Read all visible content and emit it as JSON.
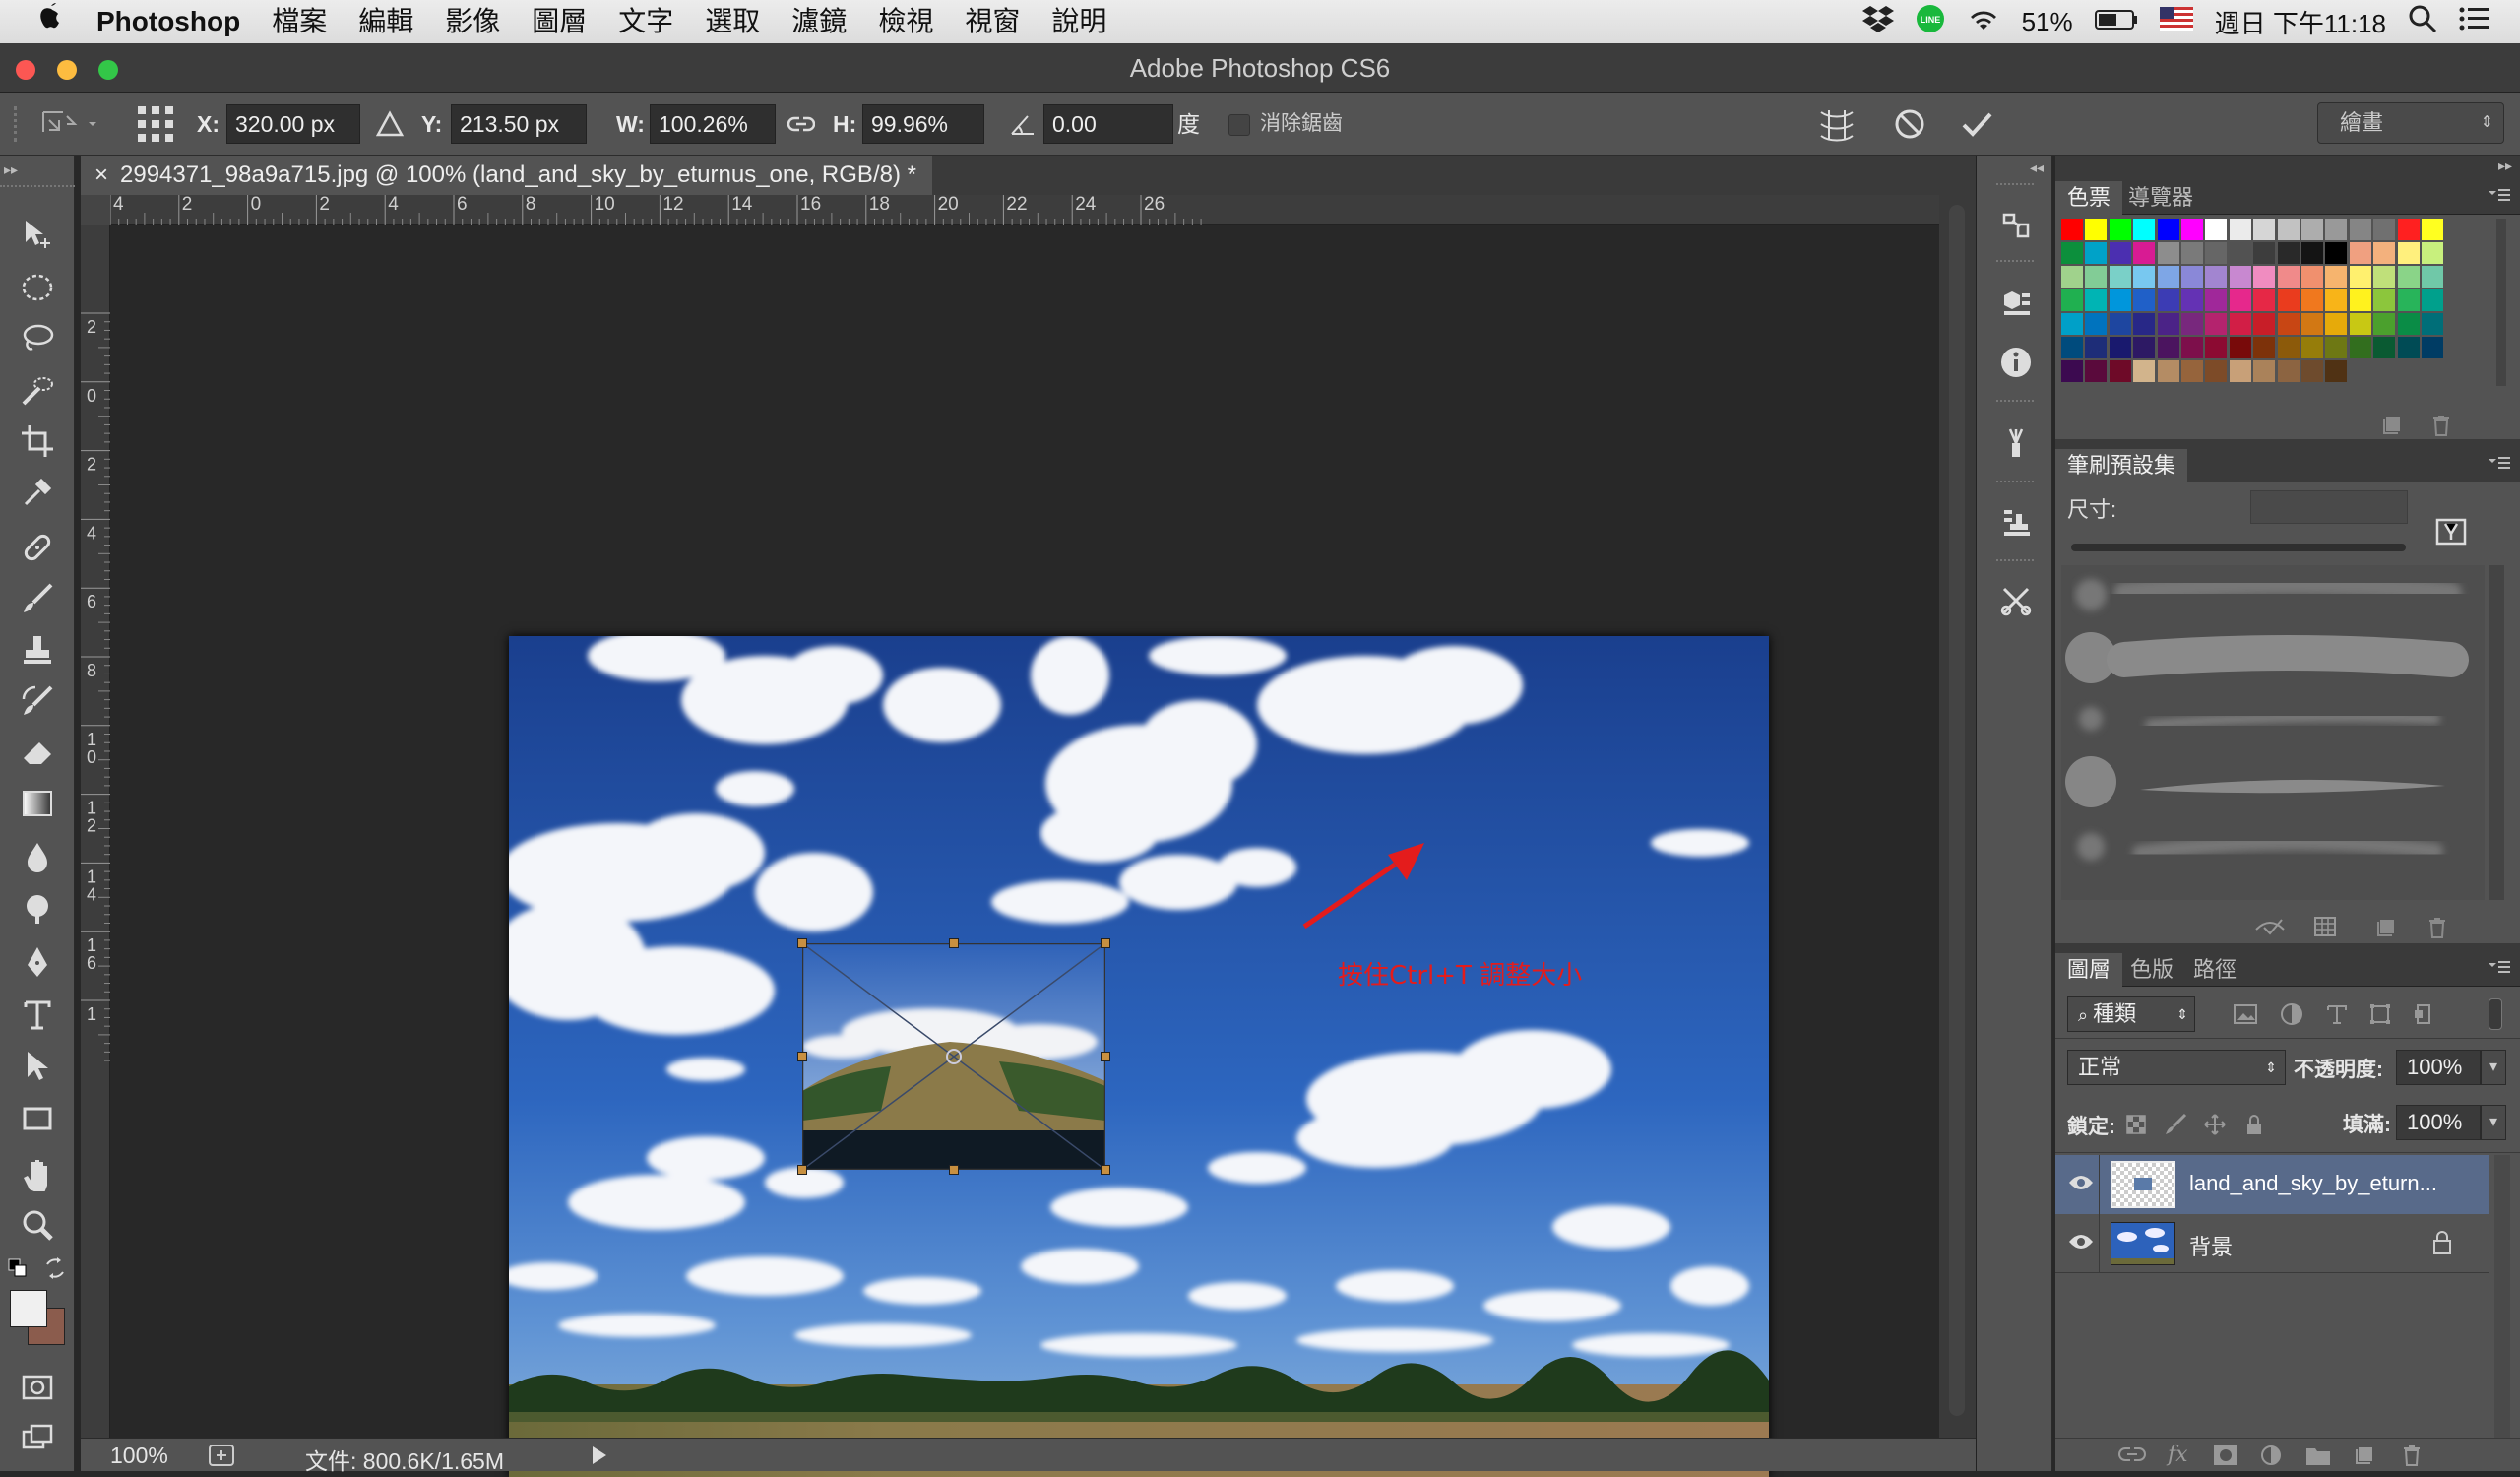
{
  "menubar": {
    "apple": "",
    "app": "Photoshop",
    "items": [
      "檔案",
      "編輯",
      "影像",
      "圖層",
      "文字",
      "選取",
      "濾鏡",
      "檢視",
      "視窗",
      "說明"
    ],
    "battery": "51%",
    "clock": "週日 下午11:18"
  },
  "window": {
    "title": "Adobe Photoshop CS6"
  },
  "options": {
    "x_label": "X:",
    "x_value": "320.00 px",
    "y_label": "Y:",
    "y_value": "213.50 px",
    "w_label": "W:",
    "w_value": "100.26%",
    "h_label": "H:",
    "h_value": "99.96%",
    "angle_value": "0.00",
    "angle_unit": "度",
    "antialias_label": "消除鋸齒",
    "workspace": "繪畫"
  },
  "document": {
    "tab_title": "2994371_98a9a715.jpg @ 100% (land_and_sky_by_eturnus_one, RGB/8) *",
    "close": "×",
    "annotation": "按住Ctrl+T 調整大小"
  },
  "rulers": {
    "h_ticks": [
      "4",
      "2",
      "0",
      "2",
      "4",
      "6",
      "8",
      "10",
      "12",
      "14",
      "16",
      "18",
      "20",
      "22",
      "24",
      "26"
    ],
    "v_ticks": [
      "2",
      "0",
      "2",
      "4",
      "6",
      "8",
      "1\n0",
      "1\n2",
      "1\n4",
      "1\n6",
      "1"
    ]
  },
  "status": {
    "zoom": "100%",
    "doc_info": "文件: 800.6K/1.65M"
  },
  "panels": {
    "swatches_tab": "色票",
    "navigator_tab": "導覽器",
    "brush_presets_tab": "筆刷預設集",
    "size_label": "尺寸:",
    "layers_tab": "圖層",
    "channels_tab": "色版",
    "paths_tab": "路徑",
    "kind_filter": "種類",
    "blend_mode": "正常",
    "opacity_label": "不透明度:",
    "opacity_value": "100%",
    "lock_label": "鎖定:",
    "fill_label": "填滿:",
    "fill_value": "100%"
  },
  "layers": [
    {
      "name": "land_and_sky_by_eturn...",
      "selected": true
    },
    {
      "name": "背景",
      "selected": false,
      "locked": true
    }
  ],
  "swatch_colors": [
    [
      "#ff0000",
      "#ffff00",
      "#00ff00",
      "#00ffff",
      "#0000ff",
      "#ff00ff",
      "#ffffff",
      "#ebebeb",
      "#d6d6d6",
      "#c2c2c2",
      "#adadad",
      "#999999",
      "#858585",
      "#707070",
      "#ff2020",
      "#ffff20"
    ],
    [
      "#0c8f3c",
      "#00a2c8",
      "#4b2fb0",
      "#d81b93",
      "#8d8d8d",
      "#7a7a7a",
      "#666666",
      "#525252",
      "#3d3d3d",
      "#292929",
      "#141414",
      "#000000",
      "#f0a080",
      "#f3b17d",
      "#fff07d",
      "#c8f07d"
    ],
    [
      "#a0d28c",
      "#82cc96",
      "#7ad0c8",
      "#78c8f0",
      "#7ea6e6",
      "#8a88d8",
      "#a285d0",
      "#c888d0",
      "#f08cc0",
      "#f08a8a",
      "#f0906e",
      "#f6b46e",
      "#fff06e",
      "#c0e07a",
      "#8ad488",
      "#70c8a8"
    ],
    [
      "#20b050",
      "#00b4b4",
      "#0096dc",
      "#2060c8",
      "#3c3cb4",
      "#6432b4",
      "#a0289a",
      "#e6288c",
      "#e62846",
      "#ea3c1e",
      "#f0781e",
      "#f8b418",
      "#fff21e",
      "#8cc63c",
      "#28b45a",
      "#00a08c"
    ],
    [
      "#00a0c8",
      "#0073be",
      "#1e46a0",
      "#282887",
      "#4b2387",
      "#78287d",
      "#b4236e",
      "#d21e46",
      "#c81e28",
      "#c84614",
      "#d27814",
      "#e6aa0a",
      "#c8c814",
      "#4ba02d",
      "#0a8c46",
      "#006e78"
    ],
    [
      "#004b7d",
      "#1e2d78",
      "#19196e",
      "#2d1964",
      "#4b145f",
      "#7d0f4b",
      "#8c0a32",
      "#780a0a",
      "#7d320a",
      "#8c5a0a",
      "#967d0a",
      "#6e7814",
      "#326e1e",
      "#0a5a32",
      "#004b55",
      "#003c64"
    ],
    [
      "#3c0a50",
      "#5a0a3c",
      "#6e0a28",
      "#d2b48c",
      "#b48c64",
      "#96643c",
      "#7d4b28",
      "#c8a078",
      "#aa825a",
      "#8c6441",
      "#6e4b2d",
      "#503214"
    ]
  ]
}
